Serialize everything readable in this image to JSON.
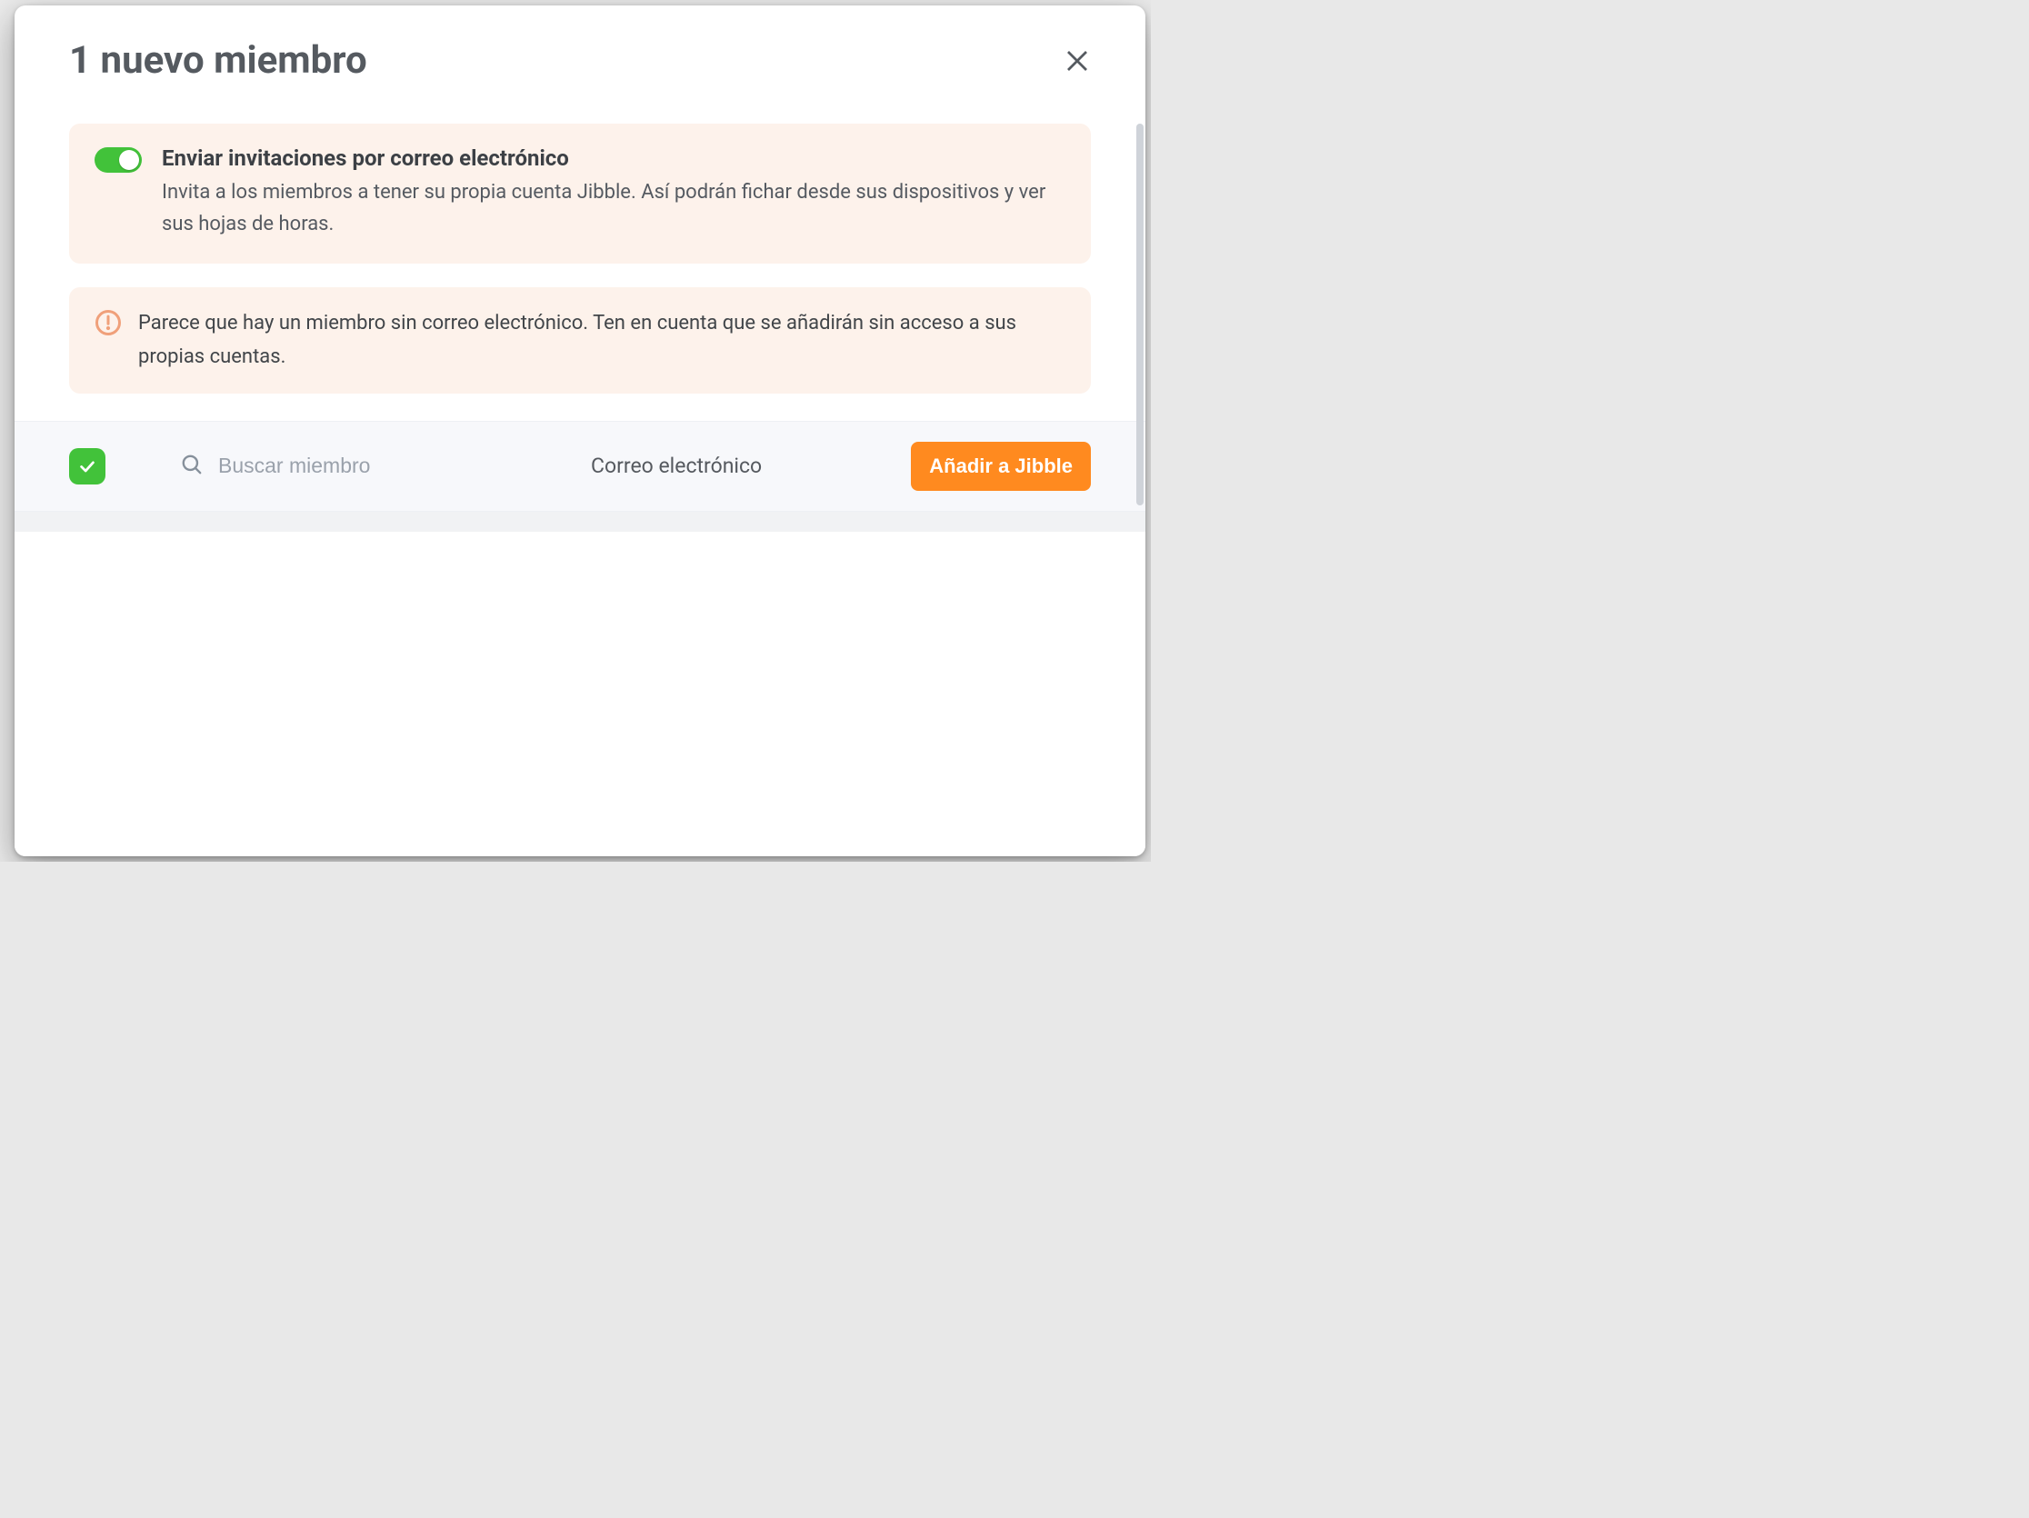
{
  "modal": {
    "title": "1 nuevo miembro"
  },
  "invite": {
    "title": "Enviar invitaciones por correo electrónico",
    "description": "Invita a los miembros a tener su propia cuenta Jibble. Así podrán fichar desde sus dispositivos y ver sus hojas de horas.",
    "enabled": true
  },
  "warning": {
    "text": "Parece que hay un miembro sin correo electrónico. Ten en cuenta que se añadirán sin acceso a sus propias cuentas."
  },
  "table": {
    "search_placeholder": "Buscar miembro",
    "email_header": "Correo electrónico",
    "add_button": "Añadir a Jibble",
    "all_checked": true
  },
  "colors": {
    "accent_green": "#42c23a",
    "accent_orange": "#ff8a1f",
    "card_bg": "#fdf2eb"
  }
}
